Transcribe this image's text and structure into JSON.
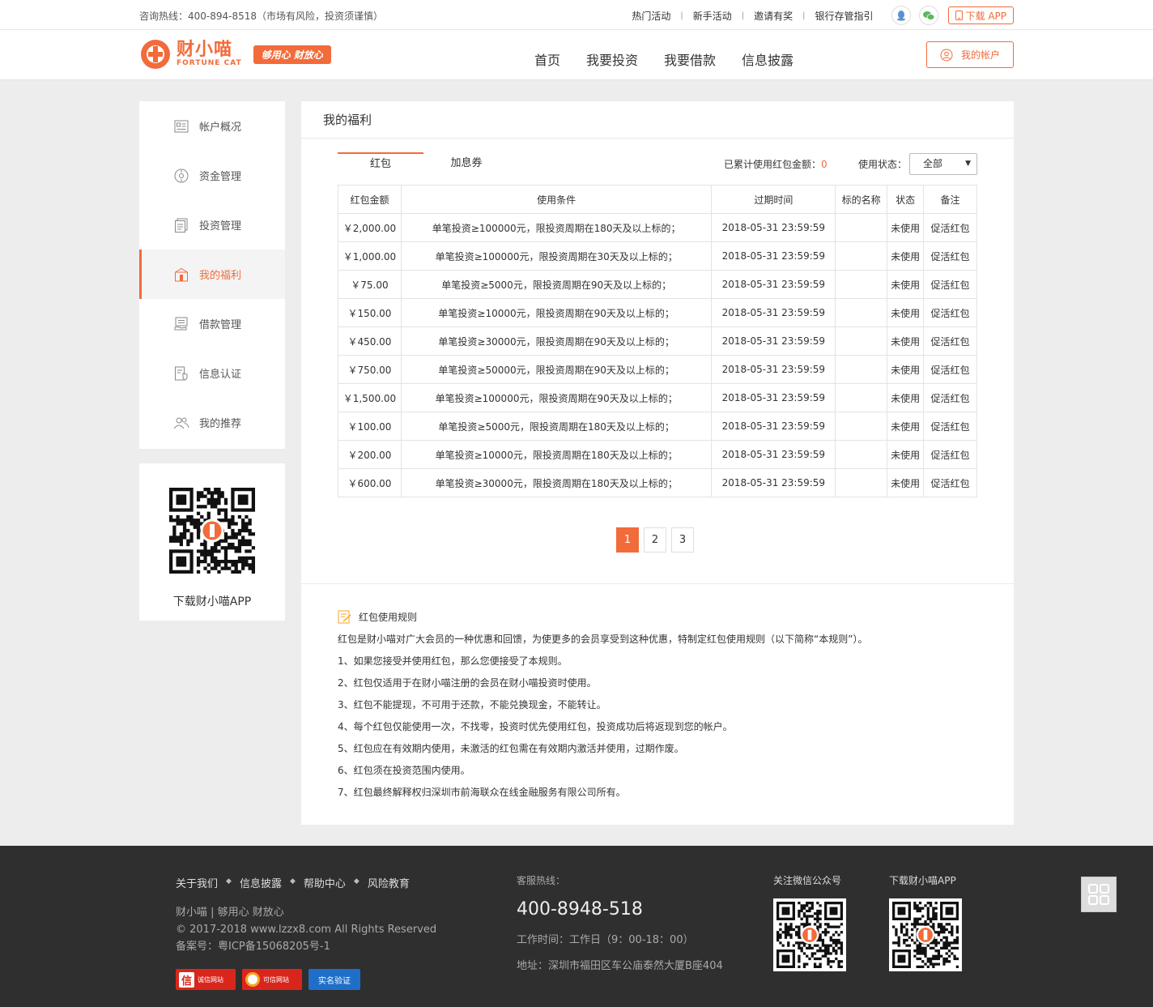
{
  "topbar": {
    "hotline": "咨询热线：400-894-8518（市场有风险，投资须谨慎）",
    "links": [
      "热门活动",
      "新手活动",
      "邀请有奖",
      "银行存管指引"
    ],
    "download_app": "下载 APP",
    "icons": [
      "qq-icon",
      "wechat-icon",
      "phone-icon"
    ]
  },
  "header": {
    "logo_cn": "财小喵",
    "logo_en": "FORTUNE CAT",
    "slogan": "够用心 财放心",
    "nav": [
      "首页",
      "我要投资",
      "我要借款",
      "信息披露"
    ],
    "account_button": "我的帐户"
  },
  "sidebar": {
    "items": [
      {
        "label": "帐户概况",
        "icon": "id-card-icon"
      },
      {
        "label": "资金管理",
        "icon": "fund-icon"
      },
      {
        "label": "投资管理",
        "icon": "document-icon"
      },
      {
        "label": "我的福利",
        "icon": "gift-icon",
        "active": true
      },
      {
        "label": "借款管理",
        "icon": "loan-icon"
      },
      {
        "label": "信息认证",
        "icon": "shield-doc-icon"
      },
      {
        "label": "我的推荐",
        "icon": "users-icon"
      }
    ],
    "qr_caption": "下载财小喵APP"
  },
  "main": {
    "title": "我的福利",
    "tabs": [
      {
        "label": "红包",
        "active": true
      },
      {
        "label": "加息券",
        "active": false
      }
    ],
    "used_sum_label": "已累计使用红包金额：",
    "used_sum_value": "0",
    "status_label": "使用状态：",
    "status_value": "全部",
    "table": {
      "headers": [
        "红包金额",
        "使用条件",
        "过期时间",
        "标的名称",
        "状态",
        "备注"
      ],
      "rows": [
        [
          "￥2,000.00",
          "单笔投资≥100000元，限投资周期在180天及以上标的；",
          "2018-05-31 23:59:59",
          "",
          "未使用",
          "促活红包"
        ],
        [
          "￥1,000.00",
          "单笔投资≥100000元，限投资周期在30天及以上标的；",
          "2018-05-31 23:59:59",
          "",
          "未使用",
          "促活红包"
        ],
        [
          "￥75.00",
          "单笔投资≥5000元，限投资周期在90天及以上标的；",
          "2018-05-31 23:59:59",
          "",
          "未使用",
          "促活红包"
        ],
        [
          "￥150.00",
          "单笔投资≥10000元，限投资周期在90天及以上标的；",
          "2018-05-31 23:59:59",
          "",
          "未使用",
          "促活红包"
        ],
        [
          "￥450.00",
          "单笔投资≥30000元，限投资周期在90天及以上标的；",
          "2018-05-31 23:59:59",
          "",
          "未使用",
          "促活红包"
        ],
        [
          "￥750.00",
          "单笔投资≥50000元，限投资周期在90天及以上标的；",
          "2018-05-31 23:59:59",
          "",
          "未使用",
          "促活红包"
        ],
        [
          "￥1,500.00",
          "单笔投资≥100000元，限投资周期在90天及以上标的；",
          "2018-05-31 23:59:59",
          "",
          "未使用",
          "促活红包"
        ],
        [
          "￥100.00",
          "单笔投资≥5000元，限投资周期在180天及以上标的；",
          "2018-05-31 23:59:59",
          "",
          "未使用",
          "促活红包"
        ],
        [
          "￥200.00",
          "单笔投资≥10000元，限投资周期在180天及以上标的；",
          "2018-05-31 23:59:59",
          "",
          "未使用",
          "促活红包"
        ],
        [
          "￥600.00",
          "单笔投资≥30000元，限投资周期在180天及以上标的；",
          "2018-05-31 23:59:59",
          "",
          "未使用",
          "促活红包"
        ]
      ]
    },
    "pagination": {
      "pages": [
        "1",
        "2",
        "3"
      ],
      "current": "1"
    },
    "rules": {
      "title": "红包使用规则",
      "lines": [
        "红包是财小喵对广大会员的一种优惠和回馈，为使更多的会员享受到这种优惠，特制定红包使用规则（以下简称“本规则”）。",
        "1、如果您接受并使用红包，那么您便接受了本规则。",
        "2、红包仅适用于在财小喵注册的会员在财小喵投资时使用。",
        "3、红包不能提现，不可用于还款，不能兑换现金，不能转让。",
        "4、每个红包仅能使用一次，不找零，投资时优先使用红包，投资成功后将返现到您的帐户。",
        "5、红包应在有效期内使用，未激活的红包需在有效期内激活并使用，过期作废。",
        "6、红包须在投资范围内使用。",
        "7、红包最终解释权归深圳市前海联众在线金融服务有限公司所有。"
      ]
    }
  },
  "footer": {
    "links": [
      "关于我们",
      "信息披露",
      "帮助中心",
      "风险教育"
    ],
    "copy": [
      "财小喵 | 够用心 财放心",
      "© 2017-2018 www.lzzx8.com All Rights Reserved",
      "备案号：粤ICP备15068205号-1"
    ],
    "badges": [
      "诚信网站",
      "可信网站",
      "实名验证"
    ],
    "service_label": "客服热线：",
    "phone": "400-8948-518",
    "hours": "工作时间：工作日（9：00-18：00）",
    "address": "地址：深圳市福田区车公庙泰然大厦B座404",
    "wechat_label": "关注微信公众号",
    "app_label": "下载财小喵APP"
  },
  "colors": {
    "accent": "#f26b3a",
    "footer_bg": "#2f2f2f",
    "page_bg": "#ededed"
  }
}
